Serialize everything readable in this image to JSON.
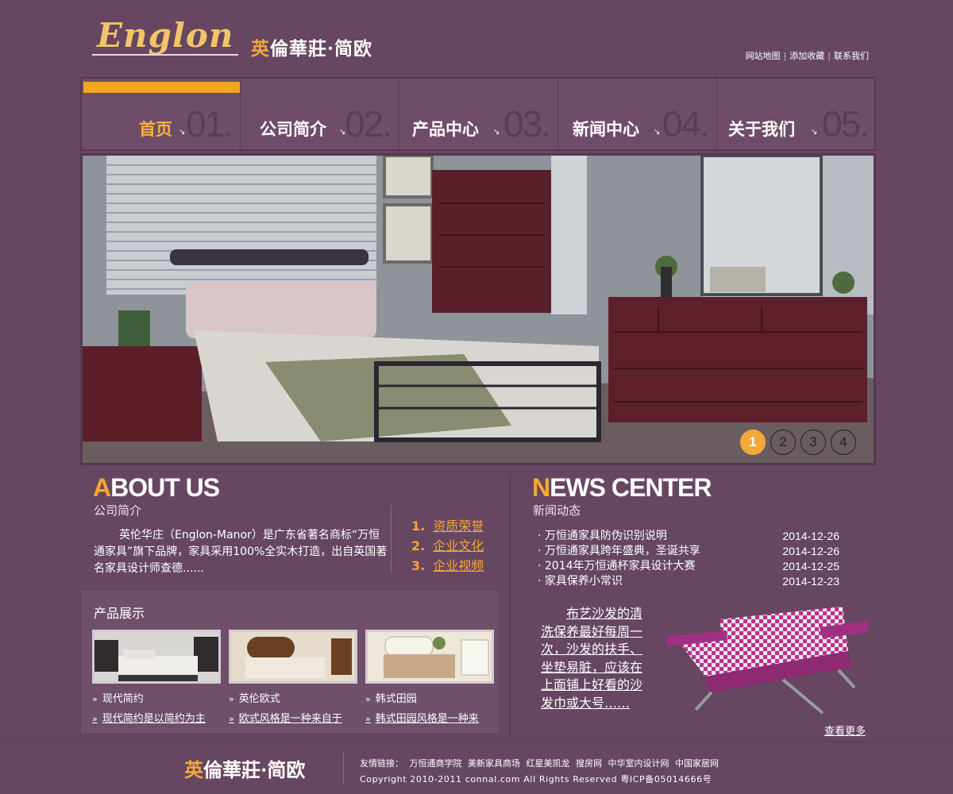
{
  "header": {
    "logo_en": "Englon",
    "logo_cn_first": "英",
    "logo_cn_rest": "倫華莊·简欧",
    "top_links": [
      "网站地图",
      "添加收藏",
      "联系我们"
    ]
  },
  "nav": {
    "items": [
      {
        "label": "首页",
        "num": "01.",
        "active": true
      },
      {
        "label": "公司简介",
        "num": "02."
      },
      {
        "label": "产品中心",
        "num": "03."
      },
      {
        "label": "新闻中心",
        "num": "04."
      },
      {
        "label": "关于我们",
        "num": "05."
      }
    ]
  },
  "banner": {
    "dots": [
      "1",
      "2",
      "3",
      "4"
    ],
    "active_dot": "1"
  },
  "about": {
    "title_cap": "A",
    "title_rest": "BOUT US",
    "subtitle": "公司简介",
    "text": "英伦华庄（Englon-Manor）是广东省著名商标“万恒通家具”旗下品牌，家具采用100%全实木打造，出自英国著名家具设计师查德......",
    "links": [
      {
        "idx": "1.",
        "label": "资质荣誉"
      },
      {
        "idx": "2.",
        "label": "企业文化"
      },
      {
        "idx": "3.",
        "label": "企业视频"
      }
    ]
  },
  "products": {
    "title": "产品展示",
    "items": [
      {
        "name": "现代简约",
        "desc": "现代简约是以简约为主"
      },
      {
        "name": "英伦欧式",
        "desc": "欧式风格是一种来自于"
      },
      {
        "name": "韩式田园",
        "desc": "韩式田园风格是一种来"
      }
    ]
  },
  "news": {
    "title_cap": "N",
    "title_rest": "EWS CENTER",
    "subtitle": "新闻动态",
    "items": [
      {
        "title": "· 万恒通家具防伪识别说明",
        "date": "2014-12-26"
      },
      {
        "title": "· 万恒通家具跨年盛典，圣诞共享",
        "date": "2014-12-26"
      },
      {
        "title": "· 2014年万恒通杯家具设计大赛",
        "date": "2014-12-25"
      },
      {
        "title": "· 家具保养小常识",
        "date": "2014-12-23"
      }
    ],
    "feature_text": "布艺沙发的清洗保养最好每周一次，沙发的扶手、坐垫易脏，应该在上面铺上好看的沙发巾或大号……",
    "more": "查看更多"
  },
  "footer": {
    "logo_first": "英",
    "logo_rest": "倫華莊·简欧",
    "links_label": "友情链接：",
    "links": [
      "万恒通商学院",
      "美新家具商场",
      "红星美凯龙",
      "搜房网",
      "中华室内设计网",
      "中国家居网"
    ],
    "copyright": "Copyright 2010-2011 connal.com All Rights Reserved 粤ICP备05014666号"
  },
  "colors": {
    "background": "#674661",
    "accent": "#f3a833",
    "text": "#ffffff"
  }
}
